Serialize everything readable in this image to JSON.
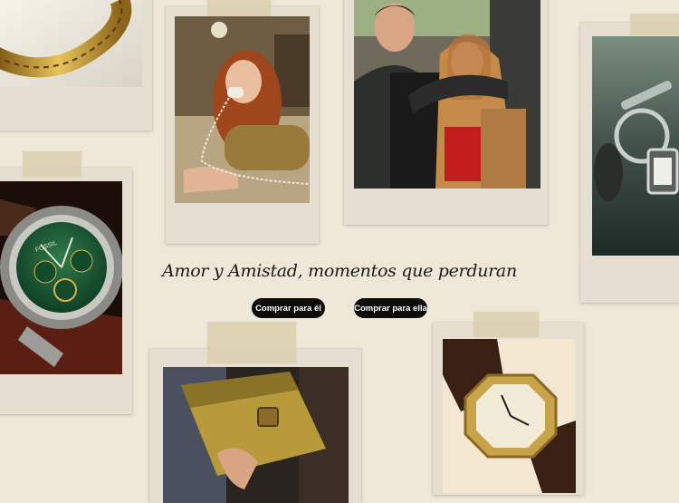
{
  "headline": "Amor y Amistad, momentos que perduran",
  "buttons": {
    "him": "Comprar para él",
    "her": "Comprar para ella"
  },
  "watch_face": {
    "brand": "FOSSIL"
  },
  "colors": {
    "background": "#efe8d9",
    "polaroid_frame": "#e6dfd1",
    "tape": "#d8cdaa",
    "button": "#0c0c0c",
    "button_text": "#ffffff",
    "headline_text": "#1a1a1a"
  },
  "photos": [
    {
      "name": "gold-bracelet-photo"
    },
    {
      "name": "woman-phone-photo"
    },
    {
      "name": "couple-photo"
    },
    {
      "name": "keys-watch-photo"
    },
    {
      "name": "green-chronograph-photo"
    },
    {
      "name": "yellow-bag-photo"
    },
    {
      "name": "octagon-watch-photo"
    }
  ]
}
